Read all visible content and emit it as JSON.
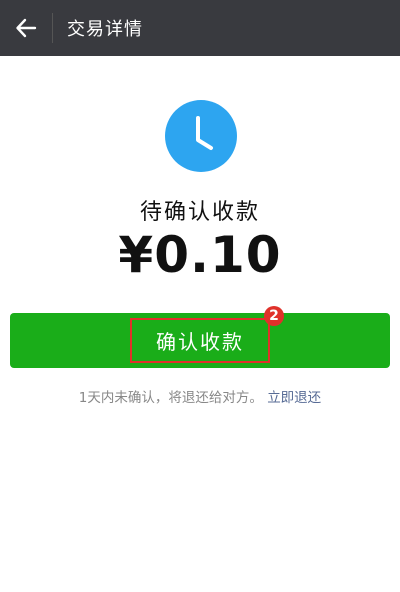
{
  "header": {
    "title": "交易详情"
  },
  "transaction": {
    "status": "待确认收款",
    "amount": "¥0.10"
  },
  "actions": {
    "confirm_label": "确认收款",
    "badge": "2"
  },
  "notice": {
    "text": "1天内未确认，将退还给对方。",
    "refund_link": "立即退还"
  },
  "colors": {
    "topbar": "#393a3f",
    "primary_green": "#1aad19",
    "clock_blue": "#2da5f0",
    "link": "#576b95",
    "highlight_red": "#e0312a"
  }
}
